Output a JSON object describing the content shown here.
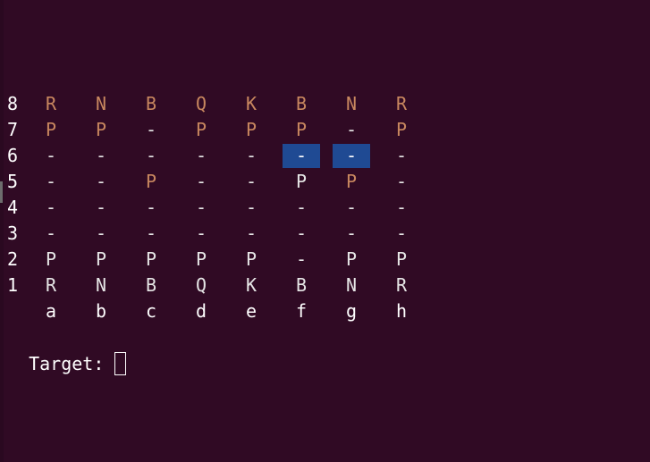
{
  "board": {
    "ranks": [
      {
        "label": "8",
        "cells": [
          {
            "text": "R",
            "color": "black"
          },
          {
            "text": "N",
            "color": "black"
          },
          {
            "text": "B",
            "color": "black"
          },
          {
            "text": "Q",
            "color": "black"
          },
          {
            "text": "K",
            "color": "black"
          },
          {
            "text": "B",
            "color": "black"
          },
          {
            "text": "N",
            "color": "black"
          },
          {
            "text": "R",
            "color": "black"
          }
        ]
      },
      {
        "label": "7",
        "cells": [
          {
            "text": "P",
            "color": "black"
          },
          {
            "text": "P",
            "color": "black"
          },
          {
            "text": "-",
            "color": "empty"
          },
          {
            "text": "P",
            "color": "black"
          },
          {
            "text": "P",
            "color": "black"
          },
          {
            "text": "P",
            "color": "black"
          },
          {
            "text": "-",
            "color": "empty"
          },
          {
            "text": "P",
            "color": "black"
          }
        ]
      },
      {
        "label": "6",
        "cells": [
          {
            "text": "-",
            "color": "empty"
          },
          {
            "text": "-",
            "color": "empty"
          },
          {
            "text": "-",
            "color": "empty"
          },
          {
            "text": "-",
            "color": "empty"
          },
          {
            "text": "-",
            "color": "empty"
          },
          {
            "text": "-",
            "color": "empty",
            "highlight": true
          },
          {
            "text": "-",
            "color": "empty",
            "highlight": true
          },
          {
            "text": "-",
            "color": "empty"
          }
        ]
      },
      {
        "label": "5",
        "cells": [
          {
            "text": "-",
            "color": "empty"
          },
          {
            "text": "-",
            "color": "empty"
          },
          {
            "text": "P",
            "color": "black"
          },
          {
            "text": "-",
            "color": "empty"
          },
          {
            "text": "-",
            "color": "empty"
          },
          {
            "text": "P",
            "color": "white"
          },
          {
            "text": "P",
            "color": "black"
          },
          {
            "text": "-",
            "color": "empty"
          }
        ]
      },
      {
        "label": "4",
        "cells": [
          {
            "text": "-",
            "color": "empty"
          },
          {
            "text": "-",
            "color": "empty"
          },
          {
            "text": "-",
            "color": "empty"
          },
          {
            "text": "-",
            "color": "empty"
          },
          {
            "text": "-",
            "color": "empty"
          },
          {
            "text": "-",
            "color": "empty"
          },
          {
            "text": "-",
            "color": "empty"
          },
          {
            "text": "-",
            "color": "empty"
          }
        ]
      },
      {
        "label": "3",
        "cells": [
          {
            "text": "-",
            "color": "empty"
          },
          {
            "text": "-",
            "color": "empty"
          },
          {
            "text": "-",
            "color": "empty"
          },
          {
            "text": "-",
            "color": "empty"
          },
          {
            "text": "-",
            "color": "empty"
          },
          {
            "text": "-",
            "color": "empty"
          },
          {
            "text": "-",
            "color": "empty"
          },
          {
            "text": "-",
            "color": "empty"
          }
        ]
      },
      {
        "label": "2",
        "cells": [
          {
            "text": "P",
            "color": "white"
          },
          {
            "text": "P",
            "color": "white"
          },
          {
            "text": "P",
            "color": "white"
          },
          {
            "text": "P",
            "color": "white"
          },
          {
            "text": "P",
            "color": "white"
          },
          {
            "text": "-",
            "color": "empty"
          },
          {
            "text": "P",
            "color": "white"
          },
          {
            "text": "P",
            "color": "white"
          }
        ]
      },
      {
        "label": "1",
        "cells": [
          {
            "text": "R",
            "color": "white"
          },
          {
            "text": "N",
            "color": "white"
          },
          {
            "text": "B",
            "color": "white"
          },
          {
            "text": "Q",
            "color": "white"
          },
          {
            "text": "K",
            "color": "white"
          },
          {
            "text": "B",
            "color": "white"
          },
          {
            "text": "N",
            "color": "white"
          },
          {
            "text": "R",
            "color": "white"
          }
        ]
      }
    ],
    "files": [
      "a",
      "b",
      "c",
      "d",
      "e",
      "f",
      "g",
      "h"
    ]
  },
  "prompt": {
    "label": "Target:",
    "value": ""
  },
  "colors": {
    "background": "#300a24",
    "black_piece": "#c8875f",
    "white_piece": "#e6e6e6",
    "highlight": "#1f4a93"
  }
}
